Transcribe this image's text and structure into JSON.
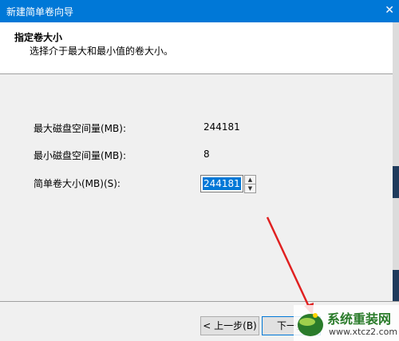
{
  "window": {
    "title": "新建简单卷向导",
    "close_glyph": "✕"
  },
  "header": {
    "title": "指定卷大小",
    "subtitle": "选择介于最大和最小值的卷大小。"
  },
  "fields": {
    "max_label": "最大磁盘空间量(MB):",
    "max_value": "244181",
    "min_label": "最小磁盘空间量(MB):",
    "min_value": "8",
    "size_label": "简单卷大小(MB)(S):",
    "size_value": "244181"
  },
  "footer": {
    "back_label": "< 上一步(B)",
    "next_label": "下一步"
  },
  "watermark": {
    "brand": "系统重装网",
    "url": "www.xtcz2.com"
  },
  "colors": {
    "accent": "#0078d7",
    "annotation_arrow": "#e02020",
    "watermark_green": "#2a7b2a"
  }
}
